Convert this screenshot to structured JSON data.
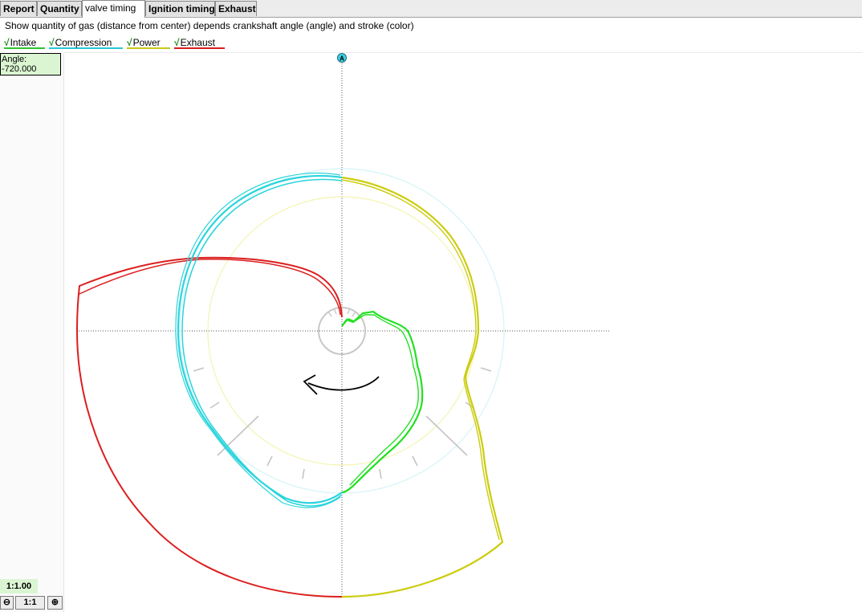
{
  "tabs": [
    {
      "label": "Report",
      "active": false
    },
    {
      "label": "Quantity",
      "active": false
    },
    {
      "label": "valve timing",
      "active": true
    },
    {
      "label": "Ignition timing",
      "active": false
    },
    {
      "label": "Exhaust",
      "active": false
    }
  ],
  "description": "Show quantity of gas (distance from center) depends crankshaft angle (angle) and stroke (color)",
  "legend": [
    {
      "check": "√",
      "label": "Intake",
      "color": "#2ec42e"
    },
    {
      "check": "√",
      "label": "Compression",
      "color": "#27c8d8"
    },
    {
      "check": "√",
      "label": "Power",
      "color": "#c8c81a"
    },
    {
      "check": "√",
      "label": "Exhaust",
      "color": "#d81e1e"
    }
  ],
  "angle_panel": {
    "label": "Angle:",
    "value": "-720.000"
  },
  "zoom": {
    "level": "1:1.00",
    "zoom_out": "⊖",
    "reset": "1:1",
    "zoom_in": "⊕"
  },
  "axis_marker": "A",
  "colors": {
    "intake": "#22e022",
    "compression": "#2ad4dc",
    "power": "#cccc10",
    "exhaust": "#dc1e1e",
    "arrow": "#000000"
  }
}
